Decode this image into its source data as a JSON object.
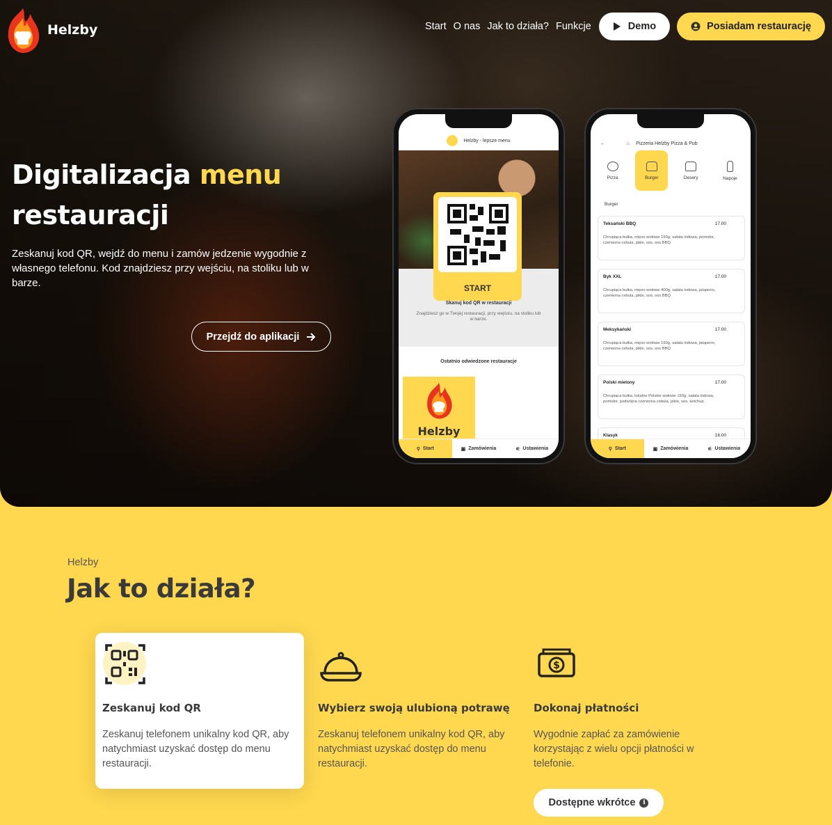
{
  "brand": {
    "name": "Helzby"
  },
  "nav": {
    "links": [
      "Start",
      "O nas",
      "Jak to działa?",
      "Funkcje"
    ],
    "demo_label": "Demo",
    "owner_label": "Posiadam restaurację"
  },
  "hero": {
    "title_part1": "Digitalizacja ",
    "title_accent": "menu",
    "title_part2": "restauracji",
    "description": "Zeskanuj kod QR, wejdź do menu i zamów jedzenie wygodnie z własnego telefonu. Kod znajdziesz przy wejściu, na stoliku lub w barze.",
    "cta_label": "Przejdź do aplikacji"
  },
  "phone1": {
    "header": "Helzby - lepsze menu",
    "start_label": "START",
    "scan_title": "Skanuj kod QR w restauracji",
    "scan_desc": "Znajdziesz go w Twojej restauracji, przy wejściu, na stoliku lub w barze.",
    "recent_title": "Ostatnio odwiedzone restauracje",
    "restaurant_name": "Helzby",
    "tabs": [
      "Start",
      "Zamówienia",
      "Ustawienia"
    ]
  },
  "phone2": {
    "header": "Pizzeria Helzby Pizza & Pub",
    "categories": [
      "Pizza",
      "Burger",
      "Desery",
      "Napoje"
    ],
    "section_label": "Burger",
    "items": [
      {
        "name": "Teksański BBQ",
        "price": "17.00",
        "desc": "Chrupiąca bułka, mięso wołowe 150g, sałata lodowa, pomidor, czerwona cebula, pikle, sos, sos BBQ"
      },
      {
        "name": "Byk XXL",
        "price": "17.00",
        "desc": "Chrupiąca bułka, mięso wołowe 400g, sałata lodowa, jalapeno, czerwona cebula, pikle, sos, sos BBQ"
      },
      {
        "name": "Meksykański",
        "price": "17.00",
        "desc": "Chrupiąca bułka, mięso wołowe 150g, sałata lodowa, jalapeno, czerwona cebula, pikle, sos, sos BBQ"
      },
      {
        "name": "Polski mielony",
        "price": "17.00",
        "desc": "Chrupiąca bułka, lokalne Polskie wołowe 150g, sałata lodowa, pomidor, podwójna czerwona cebula, pikle, sos, ketchup"
      },
      {
        "name": "Klasyk",
        "price": "16.00",
        "desc": ""
      }
    ],
    "tabs": [
      "Start",
      "Zamówienia",
      "Ustawienia"
    ]
  },
  "how": {
    "kicker": "Helzby",
    "title": "Jak to działa?",
    "steps": [
      {
        "icon": "qr-scan-icon",
        "title": "Zeskanuj kod QR",
        "desc": "Zeskanuj telefonem unikalny kod QR, aby natychmiast uzyskać dostęp do menu restauracji."
      },
      {
        "icon": "food-cloche-icon",
        "title": "Wybierz swoją ulubioną potrawę",
        "desc": "Zeskanuj telefonem unikalny kod QR, aby natychmiast uzyskać dostęp do menu restauracji."
      },
      {
        "icon": "banknote-icon",
        "title": "Dokonaj płatności",
        "desc": "Wygodnie zapłać za zamówienie korzystając z wielu opcji płatności w telefonie."
      }
    ],
    "soon_label": "Dostępne wkrótce"
  },
  "colors": {
    "accent": "#ffd84f",
    "dark_text": "#3a3a3a"
  }
}
